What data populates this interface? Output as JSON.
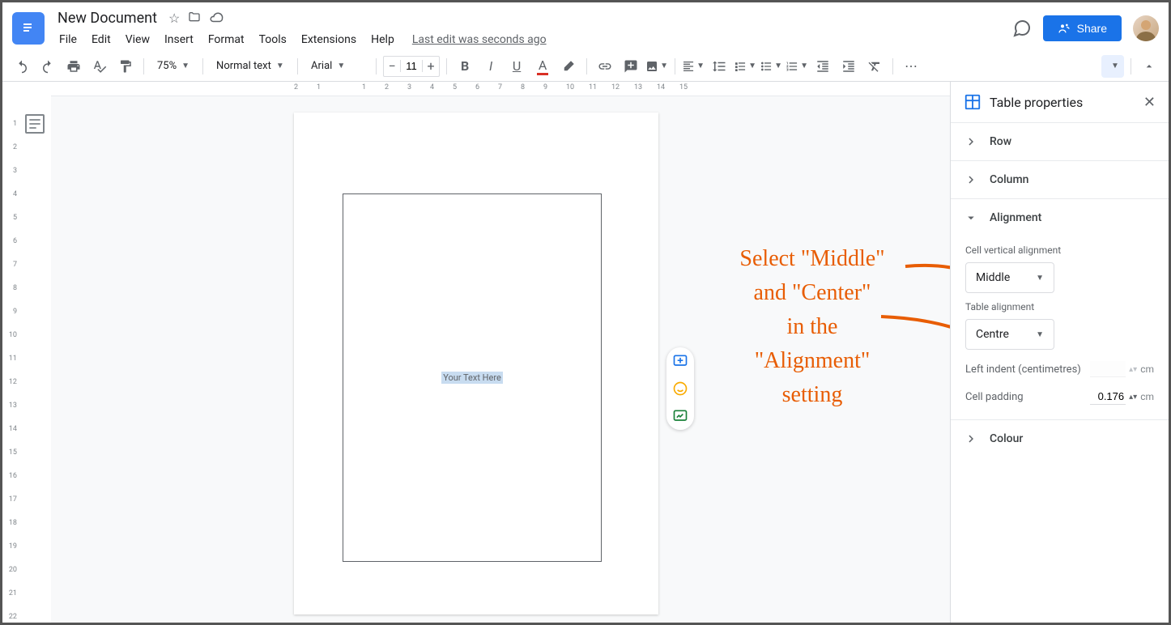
{
  "header": {
    "title": "New Document",
    "menus": [
      "File",
      "Edit",
      "View",
      "Insert",
      "Format",
      "Tools",
      "Extensions",
      "Help"
    ],
    "last_edit": "Last edit was seconds ago",
    "share_label": "Share"
  },
  "toolbar": {
    "zoom": "75%",
    "style": "Normal text",
    "font": "Arial",
    "size": "11"
  },
  "document": {
    "cell_text": "Your Text Here"
  },
  "annotation": {
    "line1": "Select \"Middle\"",
    "line2": "and \"Center\"",
    "line3": "in the",
    "line4": "\"Alignment\"",
    "line5": "setting"
  },
  "sidebar": {
    "title": "Table properties",
    "sections": {
      "row": "Row",
      "column": "Column",
      "alignment": "Alignment",
      "colour": "Colour"
    },
    "alignment": {
      "vert_label": "Cell vertical alignment",
      "vert_value": "Middle",
      "table_label": "Table alignment",
      "table_value": "Centre",
      "indent_label": "Left indent (centimetres)",
      "indent_value": "",
      "padding_label": "Cell padding",
      "padding_value": "0.176",
      "unit": "cm"
    }
  },
  "ruler_top": [
    "2",
    "1",
    "",
    "1",
    "2",
    "3",
    "4",
    "5",
    "6",
    "7",
    "8",
    "9",
    "10",
    "11",
    "12",
    "13",
    "14",
    "15"
  ],
  "ruler_left": [
    "",
    "1",
    "2",
    "3",
    "4",
    "5",
    "6",
    "7",
    "8",
    "9",
    "10",
    "11",
    "12",
    "13",
    "14",
    "15",
    "16",
    "17",
    "18",
    "19",
    "20",
    "21",
    "22"
  ]
}
